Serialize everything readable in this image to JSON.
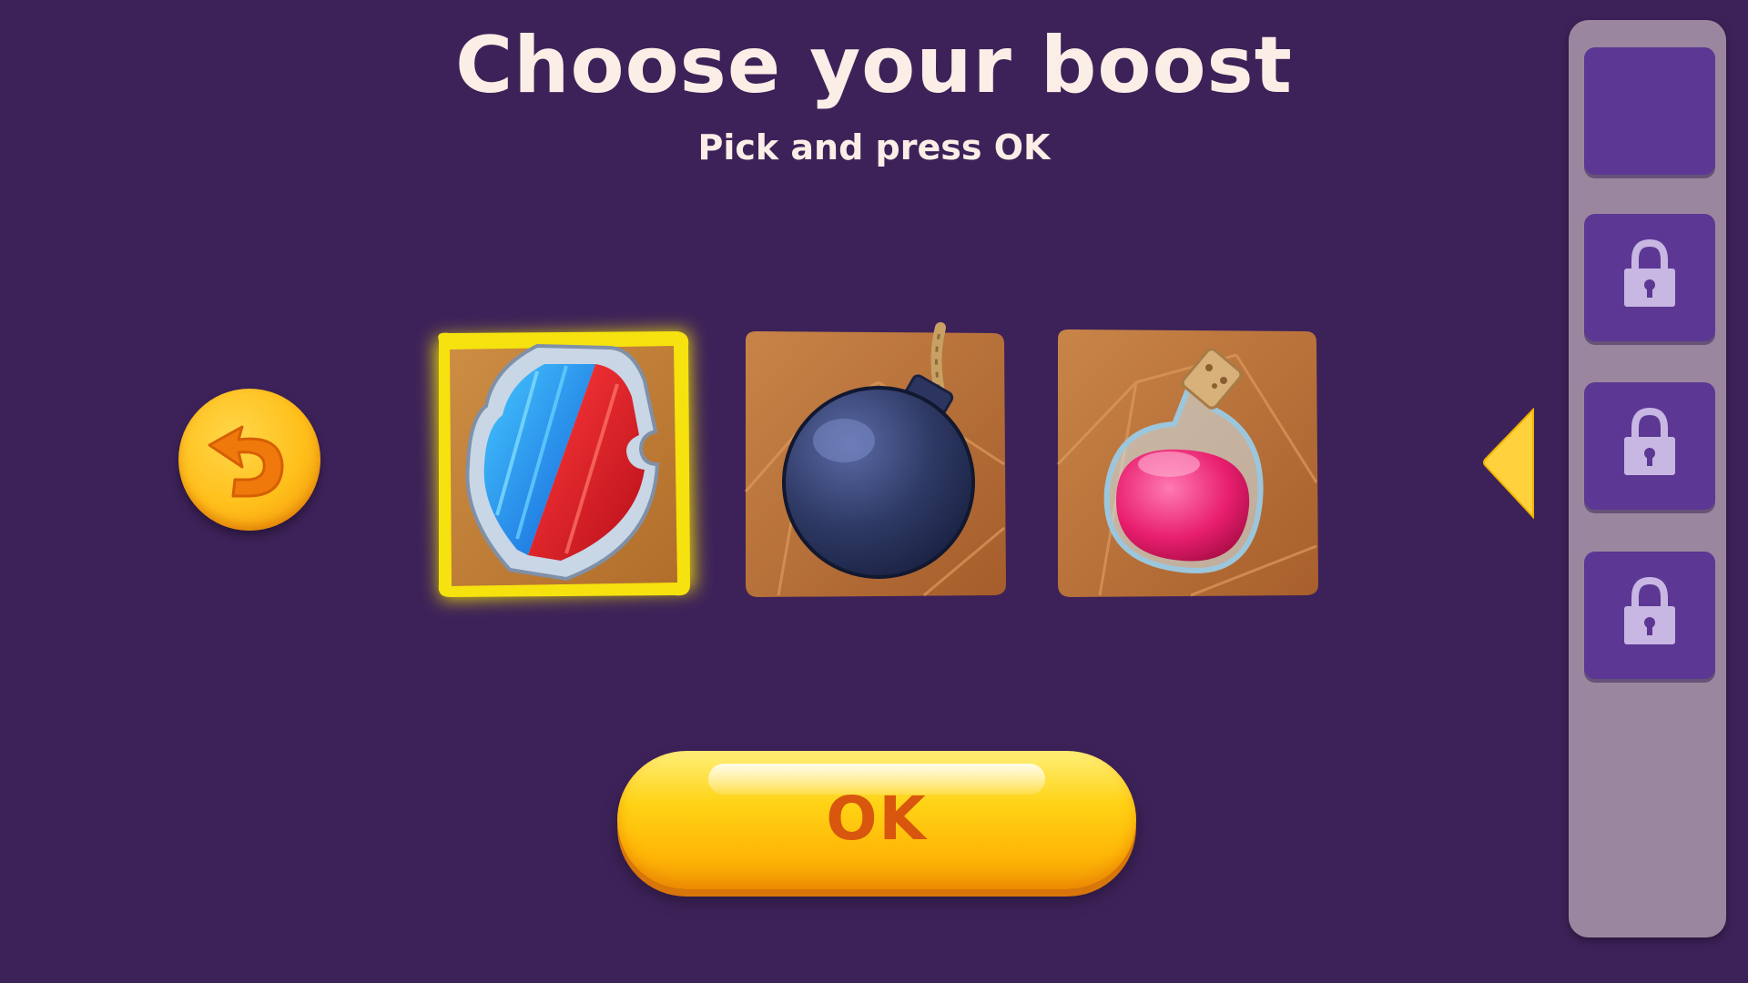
{
  "header": {
    "title": "Choose your boost",
    "subtitle": "Pick and press OK"
  },
  "boosts": [
    {
      "name": "shield",
      "icon": "shield-icon",
      "selected": true
    },
    {
      "name": "bomb",
      "icon": "bomb-icon",
      "selected": false
    },
    {
      "name": "potion",
      "icon": "potion-icon",
      "selected": false
    }
  ],
  "ok_button": {
    "label": "OK"
  },
  "back_button": {
    "icon": "back-arrow-icon"
  },
  "side_panel": {
    "slots": [
      {
        "state": "empty"
      },
      {
        "state": "locked",
        "icon": "lock-icon"
      },
      {
        "state": "locked",
        "icon": "lock-icon"
      },
      {
        "state": "locked",
        "icon": "lock-icon"
      }
    ],
    "toggle_icon": "triangle-left-icon"
  },
  "colors": {
    "background": "#3d2259",
    "text": "#fbeee6",
    "button_yellow": "#ffc21a",
    "ok_text": "#d8560e",
    "slot_purple": "#5c3793",
    "panel": "#9a879f",
    "selection_glow": "#f6e20e"
  }
}
